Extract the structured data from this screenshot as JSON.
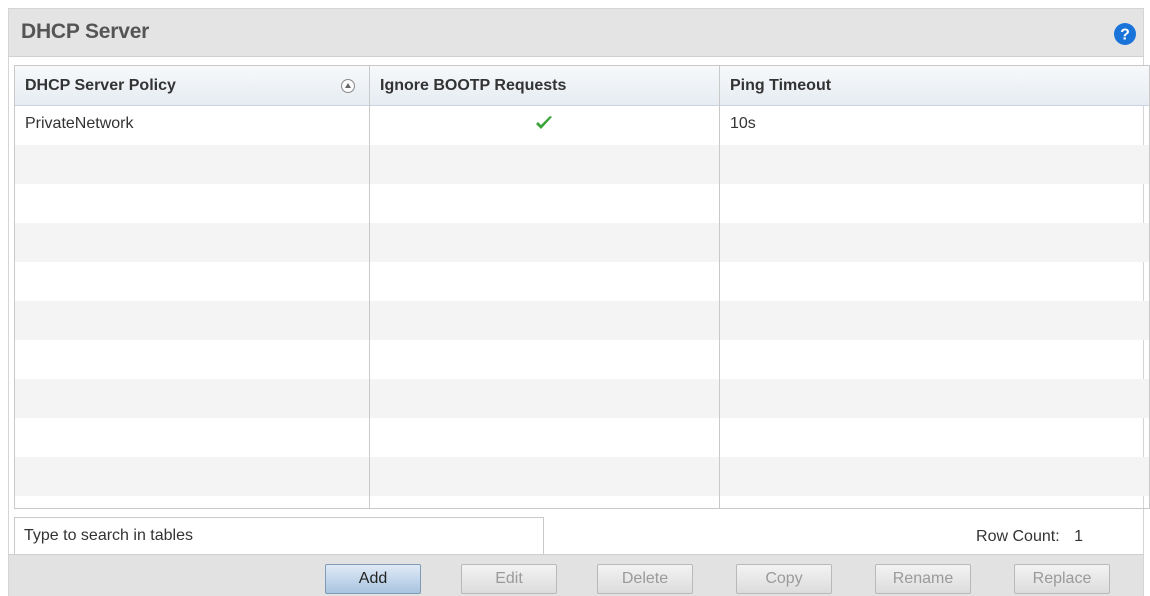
{
  "panel": {
    "title": "DHCP Server"
  },
  "icons": {
    "help": "help-icon",
    "sort": "sort-ascending-icon",
    "check": "checkmark-icon"
  },
  "colors": {
    "help_icon": "#1a73d9",
    "check": "#3aa33a",
    "primary_button": "#a9c4e0"
  },
  "table": {
    "columns": [
      "DHCP Server Policy",
      "Ignore BOOTP Requests",
      "Ping Timeout"
    ],
    "rows": [
      {
        "policy": "PrivateNetwork",
        "ignore_bootp": true,
        "ping_timeout": "10s"
      }
    ]
  },
  "search": {
    "placeholder": "Type to search in tables",
    "value": ""
  },
  "row_count": {
    "label": "Row Count:",
    "value": "1"
  },
  "buttons": {
    "add": "Add",
    "edit": "Edit",
    "delete": "Delete",
    "copy": "Copy",
    "rename": "Rename",
    "replace": "Replace"
  }
}
